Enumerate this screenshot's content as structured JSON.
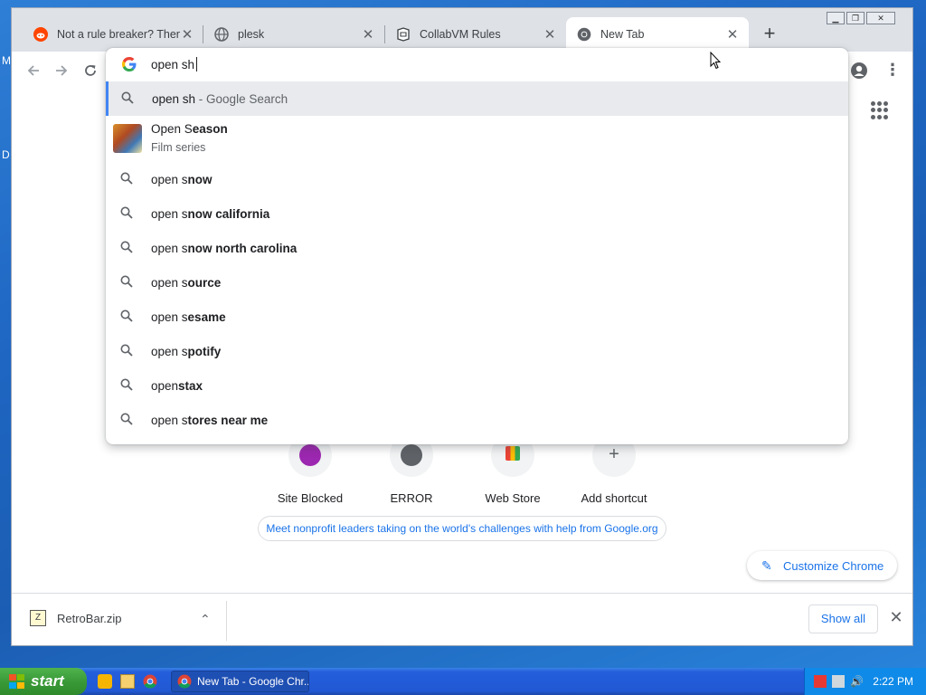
{
  "desktop": {
    "fragments": [
      "M",
      "D"
    ]
  },
  "tabs": [
    {
      "title": "Not a rule breaker? Then",
      "favicon": "reddit-icon",
      "active": false
    },
    {
      "title": "plesk",
      "favicon": "globe-icon",
      "active": false
    },
    {
      "title": "CollabVM Rules",
      "favicon": "collabvm-icon",
      "active": false
    },
    {
      "title": "New Tab",
      "favicon": "chrome-icon",
      "active": true
    }
  ],
  "tab_close_glyph": "✕",
  "new_tab_glyph": "+",
  "window_controls": [
    "minimize",
    "restore",
    "close"
  ],
  "toolbar": {
    "back": "back-arrow-icon",
    "forward": "forward-arrow-icon",
    "reload": "reload-icon"
  },
  "omnibox": {
    "value": "open sh",
    "suggestions": [
      {
        "type": "search",
        "typed": "open sh",
        "rest": "",
        "suffix": " - Google Search",
        "selected": true
      },
      {
        "type": "entity",
        "typed": "Open S",
        "rest": "eason",
        "subtitle": "Film series"
      },
      {
        "type": "search",
        "typed": "open s",
        "rest": "now"
      },
      {
        "type": "search",
        "typed": "open s",
        "rest": "now california"
      },
      {
        "type": "search",
        "typed": "open s",
        "rest": "now north carolina"
      },
      {
        "type": "search",
        "typed": "open s",
        "rest": "ource"
      },
      {
        "type": "search",
        "typed": "open s",
        "rest": "esame"
      },
      {
        "type": "search",
        "typed": "open s",
        "rest": "potify"
      },
      {
        "type": "search",
        "typed": "open",
        "rest": "stax"
      },
      {
        "type": "search",
        "typed": "open s",
        "rest": "tores near me"
      }
    ]
  },
  "shortcuts": [
    {
      "label": "Site Blocked",
      "color": "#9c27b0"
    },
    {
      "label": "ERROR",
      "color": "#5f6368"
    },
    {
      "label": "Web Store",
      "color": "#4285f4"
    },
    {
      "label": "Add shortcut",
      "color": "#5f6368"
    }
  ],
  "promo_text": "Meet nonprofit leaders taking on the world's challenges with help from Google.org",
  "customize_label": "Customize Chrome",
  "downloads": {
    "file": "RetroBar.zip",
    "show_all": "Show all"
  },
  "taskbar": {
    "start_label": "start",
    "task_label": "New Tab - Google Chr...",
    "clock": "2:22 PM"
  },
  "colors": {
    "accent": "#1a73e8",
    "tabstrip": "#dee1e6",
    "xp_blue": "#245edb",
    "xp_green": "#3a9a37"
  }
}
